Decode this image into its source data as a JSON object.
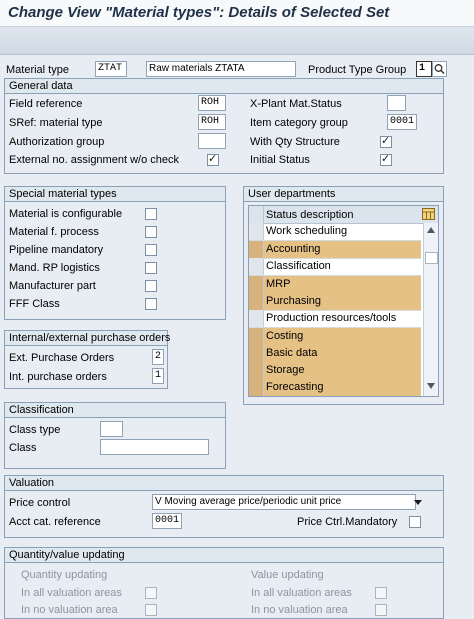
{
  "window": {
    "title": "Change View \"Material types\": Details of Selected Set"
  },
  "header": {
    "material_type_label": "Material type",
    "material_type_value": "ZTAT",
    "material_type_desc": "Raw materials ZTATA",
    "product_type_group_label": "Product Type Group",
    "product_type_group_value": "1"
  },
  "general": {
    "title": "General data",
    "field_reference_label": "Field reference",
    "field_reference_value": "ROH",
    "sref_label": "SRef: material type",
    "sref_value": "ROH",
    "auth_group_label": "Authorization group",
    "auth_group_value": "",
    "ext_no_label": "External no. assignment w/o check",
    "ext_no_checked": true,
    "xplant_label": "X-Plant Mat.Status",
    "xplant_value": "",
    "item_cat_label": "Item category group",
    "item_cat_value": "0001",
    "qty_struct_label": "With Qty Structure",
    "qty_struct_checked": true,
    "initial_status_label": "Initial Status",
    "initial_status_checked": true
  },
  "special": {
    "title": "Special material types",
    "items": [
      {
        "label": "Material is configurable",
        "checked": false
      },
      {
        "label": "Material f. process",
        "checked": false
      },
      {
        "label": "Pipeline mandatory",
        "checked": false
      },
      {
        "label": "Mand. RP logistics",
        "checked": false
      },
      {
        "label": "Manufacturer part",
        "checked": false
      },
      {
        "label": "FFF Class",
        "checked": false
      }
    ]
  },
  "user_departments": {
    "title": "User departments",
    "column_header": "Status description",
    "rows": [
      {
        "label": "Work scheduling",
        "selected": false
      },
      {
        "label": "Accounting",
        "selected": true
      },
      {
        "label": "Classification",
        "selected": false
      },
      {
        "label": "MRP",
        "selected": true
      },
      {
        "label": "Purchasing",
        "selected": true
      },
      {
        "label": "Production resources/tools",
        "selected": false
      },
      {
        "label": "Costing",
        "selected": true
      },
      {
        "label": "Basic data",
        "selected": true
      },
      {
        "label": "Storage",
        "selected": true
      },
      {
        "label": "Forecasting",
        "selected": true
      }
    ]
  },
  "purchase_orders": {
    "title": "Internal/external purchase orders",
    "ext_label": "Ext. Purchase Orders",
    "ext_value": "2",
    "int_label": "Int. purchase orders",
    "int_value": "1"
  },
  "classification": {
    "title": "Classification",
    "class_type_label": "Class type",
    "class_type_value": "",
    "class_label": "Class",
    "class_value": ""
  },
  "valuation": {
    "title": "Valuation",
    "price_control_label": "Price control",
    "price_control_value": "V Moving average price/periodic unit price",
    "acct_cat_label": "Acct cat. reference",
    "acct_cat_value": "0001",
    "price_ctrl_mandatory_label": "Price Ctrl.Mandatory",
    "price_ctrl_mandatory_checked": false
  },
  "qty_value": {
    "title": "Quantity/value updating",
    "qty_updating_label": "Quantity updating",
    "value_updating_label": "Value updating",
    "all_areas_label": "In all valuation areas",
    "no_area_label": "In no valuation area",
    "value_all_areas_label": "In all valuation areas",
    "value_no_area_label": "In no valuation area"
  },
  "colors": {
    "highlight": "#e6c186",
    "title": "#1f3148",
    "group_border": "#8aa0b8"
  },
  "icons": {
    "search": "magnifier-icon",
    "table_settings": "table-settings-icon",
    "dropdown": "chevron-down-icon"
  }
}
